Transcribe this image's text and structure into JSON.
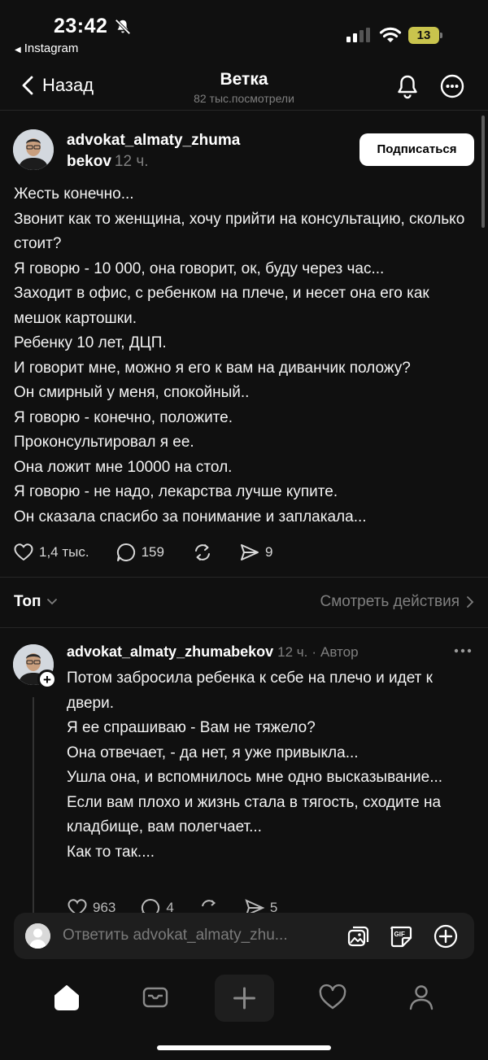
{
  "status_bar": {
    "time": "23:42",
    "back_app": "Instagram",
    "battery_level": "13"
  },
  "header": {
    "back_label": "Назад",
    "title": "Ветка",
    "subtitle": "82 тыс.посмотрели"
  },
  "post": {
    "username_line1": "advokat_almaty_zhuma",
    "username_line2": "bekov",
    "time": "12 ч.",
    "follow_label": "Подписаться",
    "lines": [
      "Жесть конечно...",
      "Звонит как то женщина, хочу прийти на консультацию, сколько стоит?",
      "Я говорю - 10 000, она говорит, ок, буду через час...",
      "Заходит в офис, с ребенком на плече, и несет она его как мешок картошки.",
      "Ребенку 10 лет, ДЦП.",
      "И говорит мне, можно я его к вам на диванчик положу?",
      "Он смирный у меня, спокойный..",
      "Я говорю - конечно, положите.",
      "Проконсультировал я ее.",
      "Она ложит мне 10000 на стол.",
      "Я говорю - не надо, лекарства лучше купите.",
      "Он сказала спасибо за понимание и заплакала..."
    ],
    "likes": "1,4 тыс.",
    "comments": "159",
    "reposts": "",
    "shares": "9"
  },
  "sort": {
    "label": "Топ",
    "view_activity": "Смотреть действия"
  },
  "reply": {
    "username": "advokat_almaty_zhumabekov",
    "time": "12 ч.",
    "separator": "·",
    "role": "Автор",
    "lines": [
      "Потом забросила ребенка к себе на плечо и идет к двери.",
      "Я ее спрашиваю - Вам не тяжело?",
      "Она отвечает, - да нет, я уже привыкла...",
      "Ушла она, и вспомнилось мне одно высказывание...",
      "Если вам плохо и жизнь стала в тягость, сходите на кладбище, вам полегчает...",
      "Как то так...."
    ],
    "likes": "963",
    "comments": "4",
    "shares": "5"
  },
  "reply_bar": {
    "placeholder": "Ответить advokat_almaty_zhu..."
  },
  "icons": {
    "status": [
      "bell-slash-icon",
      "signal-icon",
      "wifi-icon",
      "battery-icon"
    ],
    "header": [
      "chevron-left-icon",
      "bell-icon",
      "more-icon"
    ],
    "post_actions": [
      "heart-icon",
      "comment-icon",
      "repost-icon",
      "share-icon"
    ],
    "reply_bar": [
      "image-icon",
      "gif-icon",
      "plus-circle-icon"
    ],
    "tabbar": [
      "home-icon",
      "inbox-icon",
      "plus-icon",
      "heart-icon",
      "profile-icon"
    ]
  },
  "colors": {
    "background": "#101010",
    "text": "#f3f3f3",
    "muted": "#7f7f7f",
    "divider": "#262626",
    "surface": "#1e1e1e",
    "battery": "#c9c44d"
  }
}
